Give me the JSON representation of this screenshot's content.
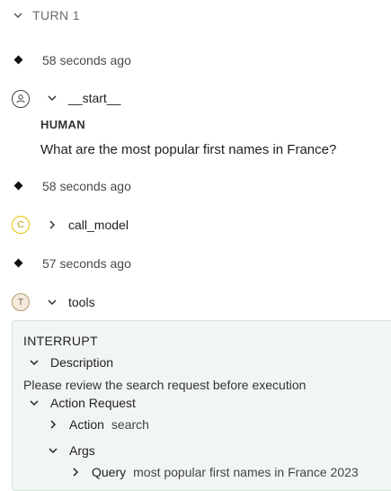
{
  "turn": {
    "label": "TURN 1"
  },
  "events": [
    {
      "time": "58 seconds ago"
    },
    {
      "time": "58 seconds ago"
    },
    {
      "time": "57 seconds ago"
    }
  ],
  "nodes": {
    "start": {
      "name": "__start__",
      "avatar_icon": "user-circle-icon"
    },
    "call_model": {
      "name": "call_model",
      "avatar_letter": "C",
      "color": "#e6c200"
    },
    "tools": {
      "name": "tools",
      "avatar_letter": "T",
      "color": "#b89a6e"
    }
  },
  "human_message": {
    "role": "HUMAN",
    "text": "What are the most popular first names in France?"
  },
  "interrupt": {
    "title": "INTERRUPT",
    "description_label": "Description",
    "description_text": "Please review the search request before execution",
    "action_request_label": "Action Request",
    "action": {
      "key": "Action",
      "value": "search"
    },
    "args_label": "Args",
    "query": {
      "key": "Query",
      "value": "most popular first names in France 2023"
    }
  }
}
